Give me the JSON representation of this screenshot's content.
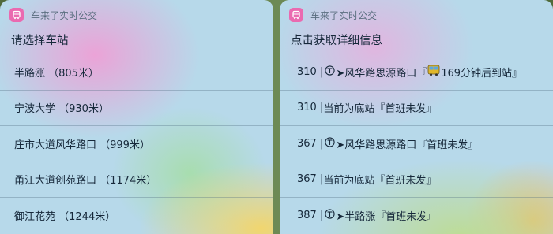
{
  "left_widget": {
    "app_name": "车来了实时公交",
    "title": "请选择车站",
    "stations": [
      {
        "label": "半路涨 （805米）"
      },
      {
        "label": "宁波大学 （930米）"
      },
      {
        "label": "庄市大道风华路口 （999米）"
      },
      {
        "label": "甬江大道创苑路口 （1174米）"
      },
      {
        "label": "御江花苑 （1244米）"
      }
    ]
  },
  "right_widget": {
    "app_name": "车来了实时公交",
    "title": "点击获取详细信息",
    "rows": [
      {
        "prefix": "310 | ",
        "has_dir": true,
        "middle": "➤风华路思源路口『",
        "has_bus": true,
        "suffix": "169分钟后到站』"
      },
      {
        "prefix": "310 | ",
        "has_dir": false,
        "middle": "当前为底站『首班未发』",
        "has_bus": false,
        "suffix": ""
      },
      {
        "prefix": "367 | ",
        "has_dir": true,
        "middle": "➤风华路思源路口『首班未发』",
        "has_bus": false,
        "suffix": ""
      },
      {
        "prefix": "367 | ",
        "has_dir": false,
        "middle": "当前为底站『首班未发』",
        "has_bus": false,
        "suffix": ""
      },
      {
        "prefix": "387 | ",
        "has_dir": true,
        "middle": "➤半路涨『首班未发』",
        "has_bus": false,
        "suffix": ""
      }
    ]
  },
  "colors": {
    "app_icon": "#ea6ab0",
    "text": "#16283a",
    "muted": "#5a6e7f"
  },
  "icons": [
    "bus-app-icon",
    "direction-icon",
    "bus-emoji-icon"
  ]
}
